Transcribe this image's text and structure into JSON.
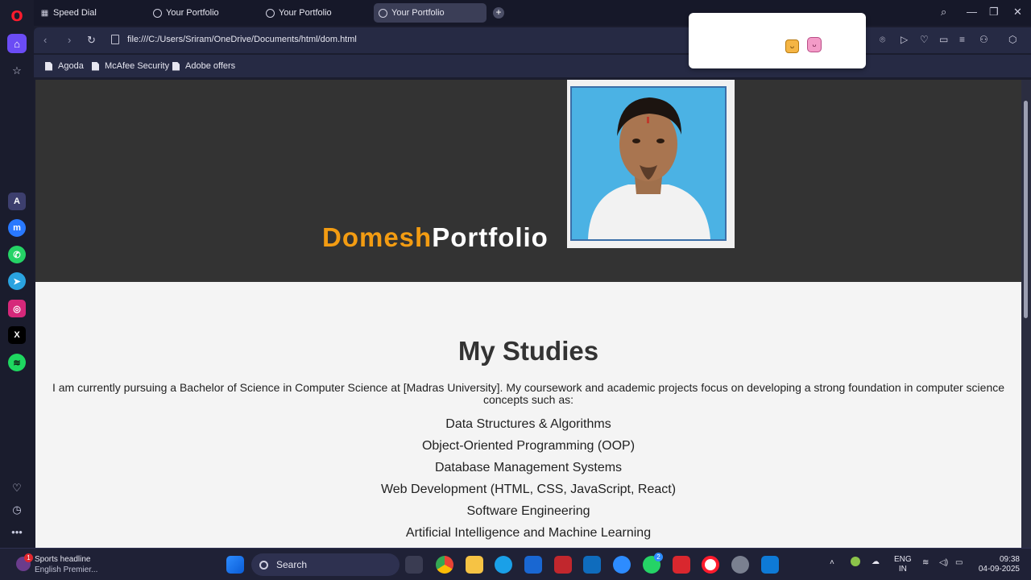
{
  "tabs": [
    {
      "label": "Speed Dial",
      "icon": "speed-dial-icon"
    },
    {
      "label": "Your Portfolio",
      "icon": "globe-icon"
    },
    {
      "label": "Your Portfolio",
      "icon": "globe-icon"
    },
    {
      "label": "Your Portfolio",
      "icon": "globe-icon",
      "active": true
    }
  ],
  "address": {
    "url": "file:///C:/Users/Sriram/OneDrive/Documents/html/dom.html"
  },
  "bookmarks": [
    "Agoda",
    "McAfee Security",
    "Adobe offers"
  ],
  "page": {
    "brand_first": "Domesh",
    "brand_second": "Portfolio",
    "studies_title": "My Studies",
    "studies_intro": "I am currently pursuing a Bachelor of Science in Computer Science at [Madras University]. My coursework and academic projects focus on developing a strong foundation in computer science concepts such as:",
    "courses": [
      "Data Structures & Algorithms",
      "Object-Oriented Programming (OOP)",
      "Database Management Systems",
      "Web Development (HTML, CSS, JavaScript, React)",
      "Software Engineering",
      "Artificial Intelligence and Machine Learning"
    ]
  },
  "taskbar": {
    "news_headline": "Sports headline",
    "news_sub": "English Premier...",
    "news_badge": "1",
    "search_label": "Search",
    "whatsapp_badge": "2",
    "lang_line1": "ENG",
    "lang_line2": "IN",
    "time": "09:38",
    "date": "04-09-2025"
  },
  "colors": {
    "accent": "#f39c12",
    "hero_bg": "#333333",
    "page_bg": "#f4f4f4",
    "opera_red": "#ff1b2d"
  }
}
